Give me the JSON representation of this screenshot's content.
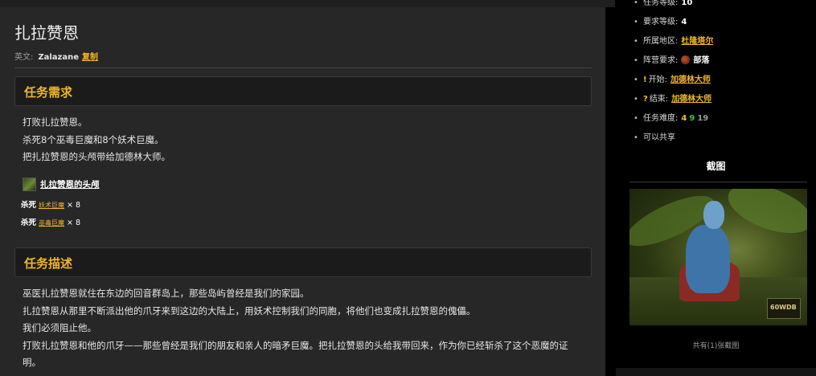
{
  "quest": {
    "title": "扎拉赞恩",
    "english_label": "英文:",
    "english_name": "Zalazane",
    "copy_label": "复制"
  },
  "requirements": {
    "heading": "任务需求",
    "lines": [
      "打败扎拉赞恩。",
      "杀死8个巫毒巨魔和8个妖术巨魔。",
      "把扎拉赞恩的头颅带给加德林大师。"
    ],
    "item_name": "扎拉赞恩的头颅",
    "kills": [
      {
        "label": "杀死",
        "mob": "妖术巨魔",
        "count": "× 8"
      },
      {
        "label": "杀死",
        "mob": "巫毒巨魔",
        "count": "× 8"
      }
    ]
  },
  "description": {
    "heading": "任务描述",
    "paragraphs": [
      "巫医扎拉赞恩就住在东边的回音群岛上，那些岛屿曾经是我们的家园。",
      "扎拉赞恩从那里不断派出他的爪牙来到这边的大陆上，用妖术控制我们的同胞，将他们也变成扎拉赞恩的傀儡。",
      "我们必须阻止他。",
      "打败扎拉赞恩和他的爪牙——那些曾经是我们的朋友和亲人的暗矛巨魔。把扎拉赞恩的头给我带回来，作为你已经斩杀了这个恶魔的证明。"
    ]
  },
  "sidebar": {
    "quest_level_label": "任务等级:",
    "quest_level": "10",
    "req_level_label": "要求等级:",
    "req_level": "4",
    "zone_label": "所属地区:",
    "zone": "杜隆塔尔",
    "faction_label": "阵营要求:",
    "faction": "部落",
    "start_label": "开始:",
    "start_npc": "加德林大师",
    "end_label": "结束:",
    "end_npc": "加德林大师",
    "difficulty_label": "任务难度:",
    "difficulty": [
      "4",
      "9",
      "19"
    ],
    "shareable": "可以共享",
    "screenshot_title": "截图",
    "screenshot_caption": "共有(1)张截图",
    "screenshot_watermark": "60WDB"
  }
}
